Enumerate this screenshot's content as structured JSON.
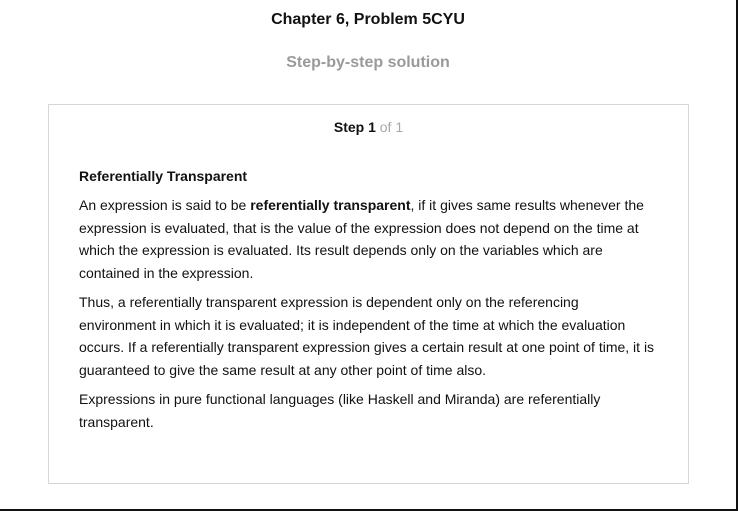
{
  "header": {
    "title": "Chapter 6, Problem 5CYU",
    "subtitle": "Step-by-step solution"
  },
  "step": {
    "label": "Step 1",
    "total": "of 1"
  },
  "solution": {
    "heading": "Referentially Transparent",
    "para1_prefix": "An expression is said to be ",
    "para1_bold": "referentially transparent",
    "para1_suffix": ", if it gives same results whenever the expression is evaluated, that is the value of the expression does not depend on the time at which the expression is evaluated. Its result depends only on the variables which are contained in the expression.",
    "para2": "Thus, a referentially transparent expression is dependent only on the referencing environment in which it is evaluated; it is independent of the time at which the evaluation occurs. If a referentially transparent expression gives a certain result at one point of time, it is guaranteed to give the same result at any other point of time also.",
    "para3": "Expressions in pure functional languages (like Haskell and Miranda) are referentially transparent."
  }
}
